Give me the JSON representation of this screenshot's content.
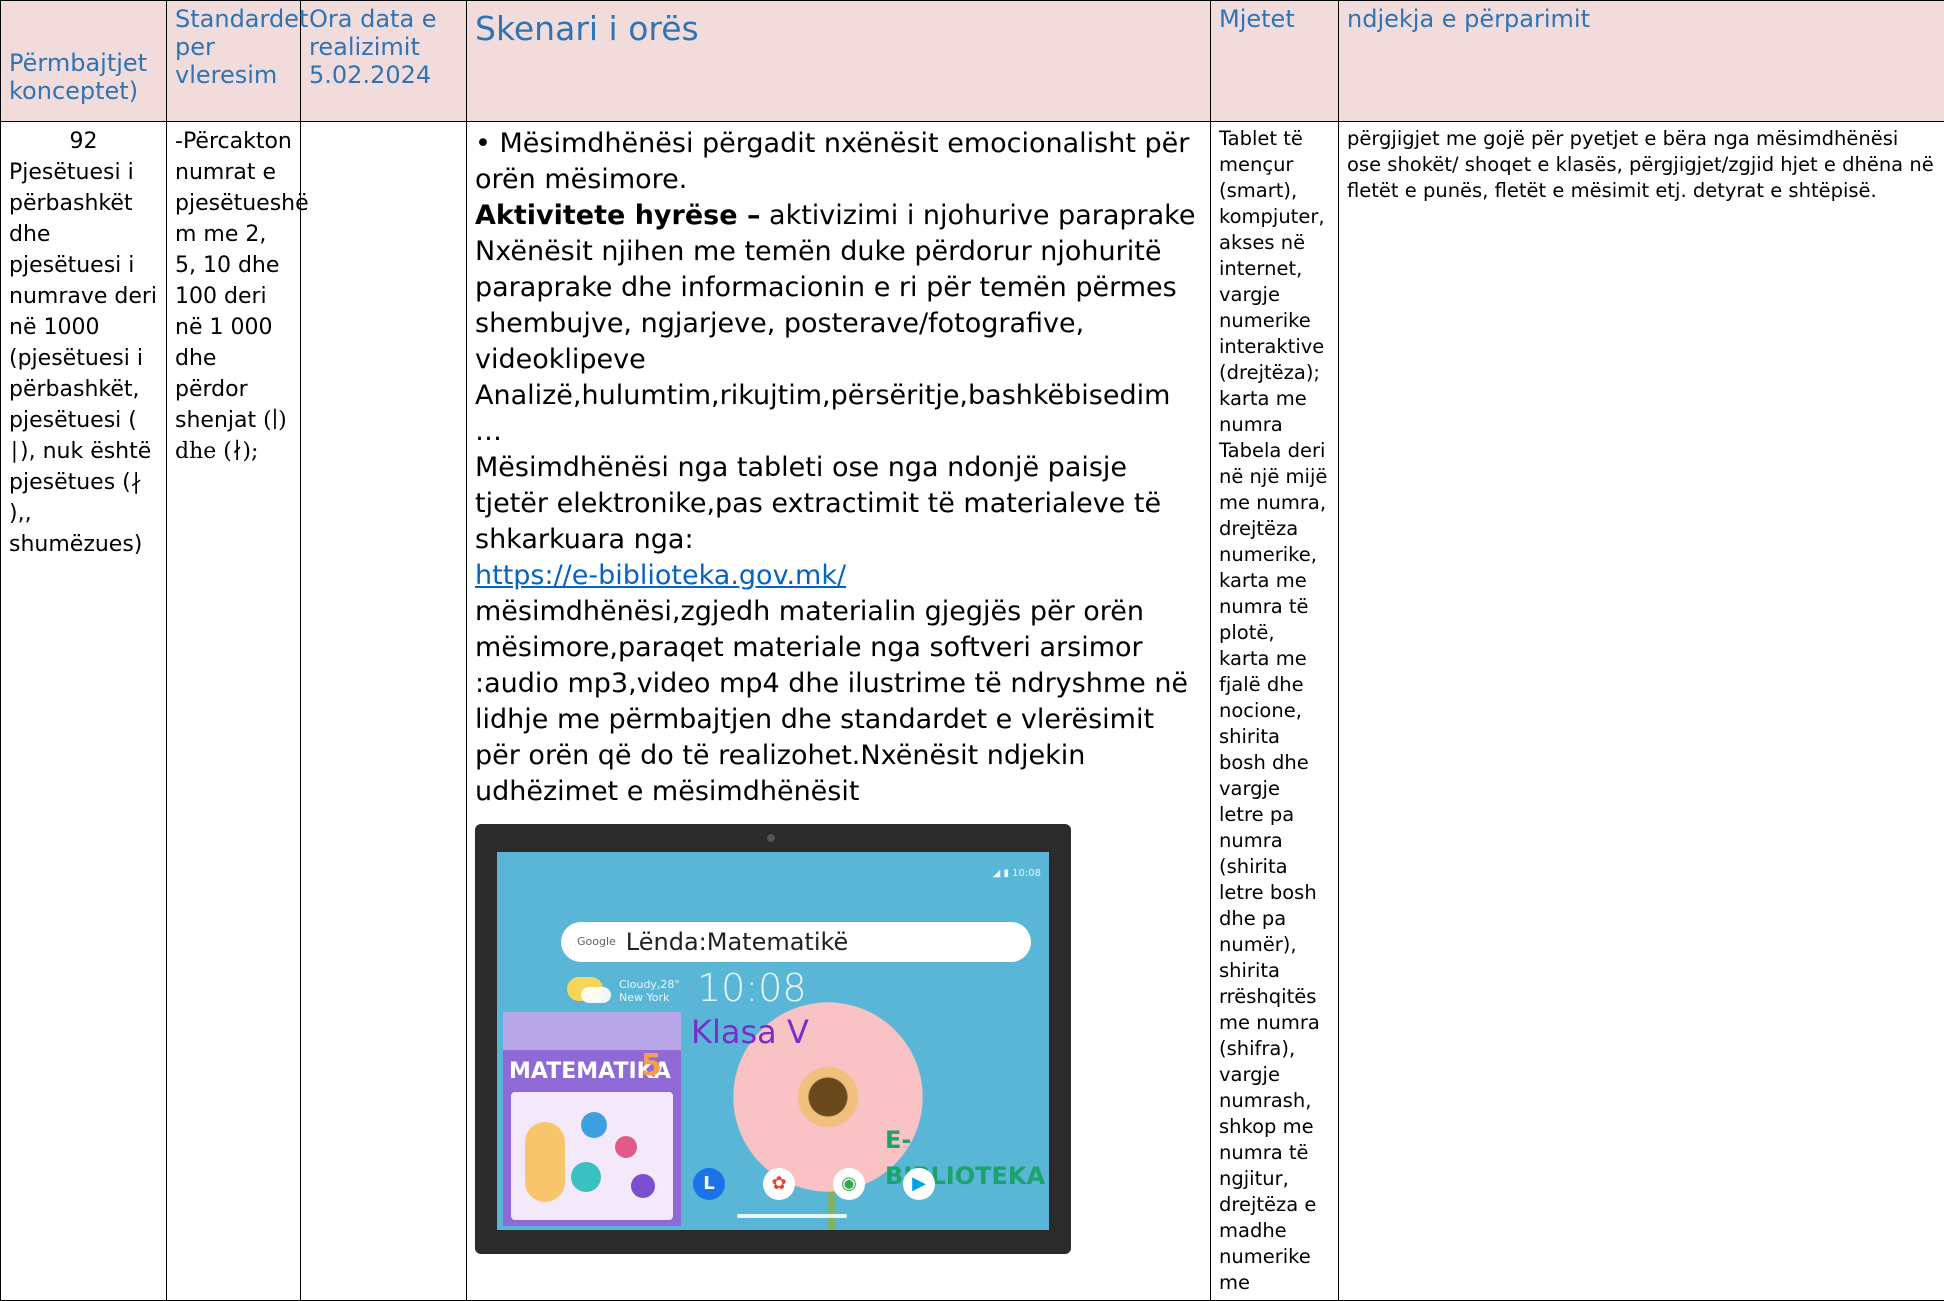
{
  "headers": {
    "col1": "Përmbajtjet konceptet)",
    "col2": "Standardet per vleresim",
    "col3_line1": "Ora data e realizimit",
    "col3_date": "5.02.2024",
    "col4": "Skenari i orës",
    "col5": "Mjetet",
    "col6": "ndjekja e përparimit"
  },
  "col1": {
    "number": "92",
    "text": "Pjesëtuesi i përbashkët dhe pjesëtuesi i numrave deri në 1000 (pjesëtuesi i përbashkët, pjesëtuesi ( ∣), nuk është pjesëtues (∤ ),, shumëzues)"
  },
  "col2": {
    "text": "-Përcakton numrat e pjesëtueshë m me 2, 5, 10 dhe 100 deri në 1 000 dhe përdor shenjat",
    "symbols": "(∣) dhe (∤);"
  },
  "scenario": {
    "p1": "• Mësimdhënësi përgadit nxënësit emocionalisht për orën mësimore.",
    "bold_label": "Aktivitete hyrëse –",
    "bold_rest": " aktivizimi i njohurive paraprake",
    "p2": "Nxënësit njihen me temën duke përdorur njohuritë paraprake dhe informacionin e ri për temën përmes shembujve, ngjarjeve, posterave/fotografive, videoklipeve",
    "p3": "Analizë,hulumtim,rikujtim,përsëritje,bashkëbisedim …",
    "p4": "Mësimdhënësi nga tableti ose nga ndonjë paisje tjetër elektronike,pas extractimit të materialeve të shkarkuara nga:",
    "link": "https://e-biblioteka.gov.mk/",
    "p5": "mësimdhënësi,zgjedh materialin gjegjës për orën mësimore,paraqet materiale nga softveri arsimor :audio mp3,video mp4 dhe ilustrime të ndryshme në lidhje me përmbajtjen dhe standardet e vlerësimit për orën që do të realizohet.Nxënësit ndjekin udhëzimet e mësimdhënësit"
  },
  "tablet_image": {
    "google_label": "Google",
    "search_text": "Lënda:Matematikë",
    "weather_line1": "Cloudy,28°",
    "weather_line2": "New York",
    "clock": "10:08",
    "book_title": "MATEMATIKA",
    "book_number": "5",
    "klasa": "Klasa V",
    "ebib": "E-BIBLIOTEKA",
    "status": "◢ ▮ 10:08"
  },
  "tools": {
    "text": "Tablet të mençur (smart), kompjuter, akses në internet, vargje numerike interaktive (drejtëza); karta me numra Tabela deri në një mijë me numra, drejtëza numerike, karta me numra të plotë, karta me fjalë dhe nocione, shirita bosh dhe vargje letre pa numra (shirita letre bosh dhe pa numër), shirita rrëshqitës me numra (shifra), vargje numrash, shkop me numra të ngjitur, drejtëza e madhe numerike me"
  },
  "tracking": {
    "text": "përgjigjet me gojë për pyetjet e bëra nga mësimdhënësi ose shokët/ shoqet e klasës, përgjigjet/zgjid hjet e dhëna në fletët e punës, fletët e mësimit etj. detyrat e shtëpisë."
  },
  "colors": {
    "header_bg": "#f2dcdb",
    "header_text": "#2e74b5",
    "link": "#0563c1"
  }
}
